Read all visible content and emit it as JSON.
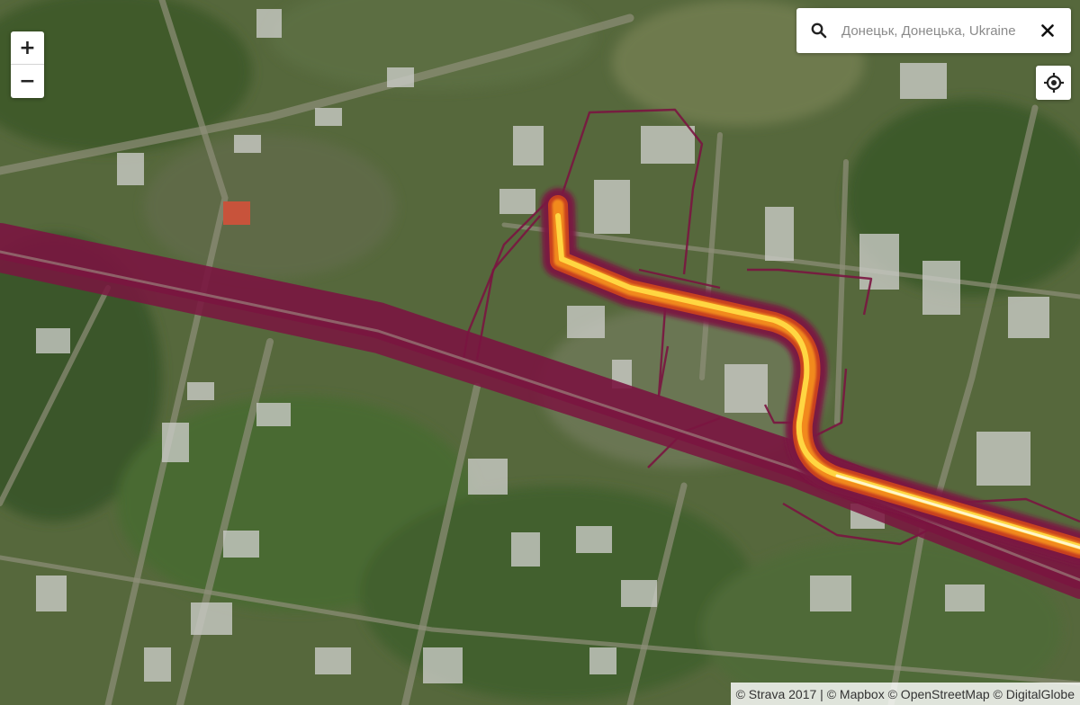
{
  "map": {
    "type": "satellite-heatmap",
    "provider": "Strava",
    "colors": {
      "heat_low": "#7a1540",
      "heat_mid": "#c8401f",
      "heat_high": "#ffd642",
      "heat_peak": "#fff6c8",
      "vegetation": "#4f6a35"
    }
  },
  "controls": {
    "zoom_in_label": "+",
    "zoom_out_label": "−",
    "zoom_in_icon": "plus-icon",
    "zoom_out_icon": "minus-icon",
    "locate_icon": "crosshair-icon"
  },
  "search": {
    "value": "",
    "placeholder": "Донецьк, Донецька, Ukraine",
    "icon": "search-icon",
    "clear_icon": "close-icon"
  },
  "attribution": {
    "items": [
      "© Strava 2017",
      "© Mapbox",
      "© OpenStreetMap",
      "© DigitalGlobe"
    ],
    "separator": " | ",
    "text": "© Strava 2017 | © Mapbox © OpenStreetMap © DigitalGlobe"
  }
}
